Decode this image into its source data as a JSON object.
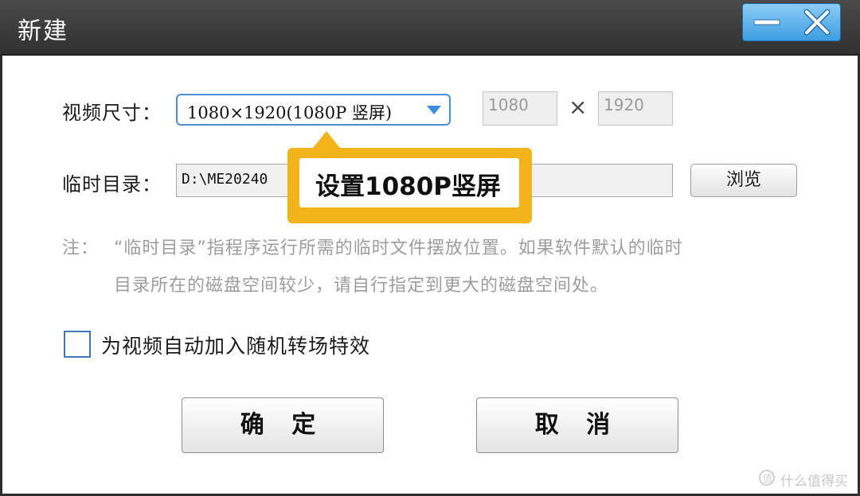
{
  "window": {
    "title": "新建",
    "minimize_icon": "minimize-icon",
    "close_icon": "close-icon",
    "accent_color": "#4ba6e8"
  },
  "video_size": {
    "label": "视频尺寸：",
    "selected": "1080×1920(1080P 竖屏)",
    "width": "1080",
    "separator": "×",
    "height": "1920"
  },
  "temp_dir": {
    "label": "临时目录：",
    "path": "D:\\ME20240",
    "browse_label": "浏览"
  },
  "note": {
    "prefix": "注：",
    "line1": "“临时目录”指程序运行所需的临时文件摆放位置。如果软件默认的临时",
    "line2": "目录所在的磁盘空间较少，请自行指定到更大的磁盘空间处。"
  },
  "options": {
    "random_transition_label": "为视频自动加入随机转场特效",
    "random_transition_checked": false
  },
  "buttons": {
    "ok_label": "确 定",
    "cancel_label": "取 消"
  },
  "annotation": {
    "text": "设置1080P竖屏",
    "color": "#f3b41b"
  },
  "watermark": {
    "text": "什么值得买"
  }
}
